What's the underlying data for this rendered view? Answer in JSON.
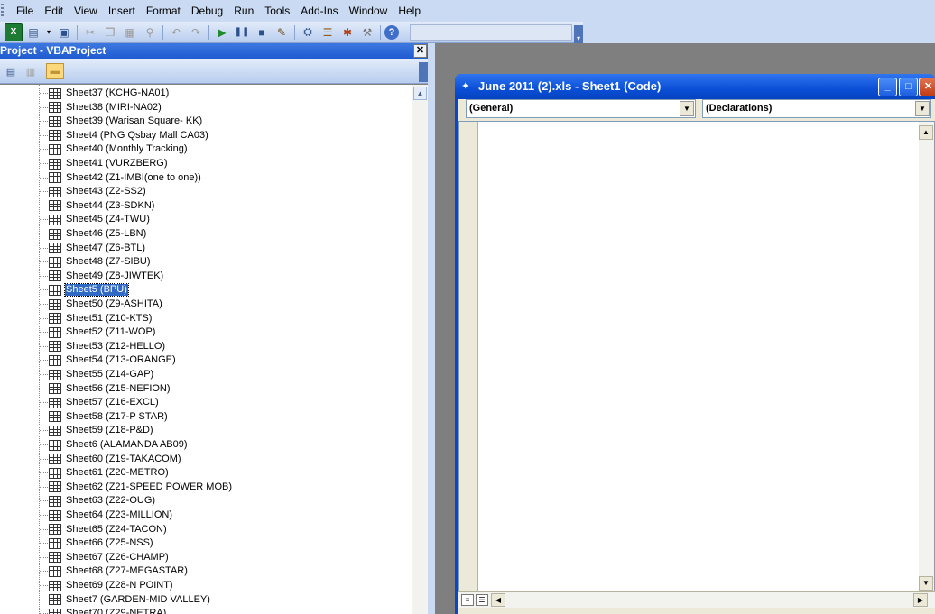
{
  "menu": {
    "items": [
      "File",
      "Edit",
      "View",
      "Insert",
      "Format",
      "Debug",
      "Run",
      "Tools",
      "Add-Ins",
      "Window",
      "Help"
    ]
  },
  "toolbar": {
    "icons": [
      "excel-icon",
      "insert-module-icon",
      "dropdown-icon",
      "save-icon",
      "cut-icon",
      "copy-icon",
      "paste-icon",
      "find-icon",
      "undo-icon",
      "redo-icon",
      "run-icon",
      "break-icon",
      "reset-icon",
      "design-mode-icon",
      "project-explorer-icon",
      "properties-icon",
      "object-browser-icon",
      "toolbox-icon",
      "help-icon"
    ]
  },
  "project": {
    "title": "Project - VBAProject",
    "close": "✕",
    "items": [
      "Sheet37 (KCHG-NA01)",
      "Sheet38 (MIRI-NA02)",
      "Sheet39 (Warisan Square- KK)",
      "Sheet4 (PNG Qsbay Mall CA03)",
      "Sheet40 (Monthly Tracking)",
      "Sheet41 (VURZBERG)",
      "Sheet42 (Z1-IMBI(one to one))",
      "Sheet43 (Z2-SS2)",
      "Sheet44 (Z3-SDKN)",
      "Sheet45 (Z4-TWU)",
      "Sheet46 (Z5-LBN)",
      "Sheet47 (Z6-BTL)",
      "Sheet48 (Z7-SIBU)",
      "Sheet49 (Z8-JIWTEK)",
      "Sheet5 (BPU)",
      "Sheet50 (Z9-ASHITA)",
      "Sheet51 (Z10-KTS)",
      "Sheet52 (Z11-WOP)",
      "Sheet53 (Z12-HELLO)",
      "Sheet54 (Z13-ORANGE)",
      "Sheet55 (Z14-GAP)",
      "Sheet56 (Z15-NEFION)",
      "Sheet57 (Z16-EXCL)",
      "Sheet58 (Z17-P STAR)",
      "Sheet59 (Z18-P&D)",
      "Sheet6 (ALAMANDA AB09)",
      "Sheet60 (Z19-TAKACOM)",
      "Sheet61 (Z20-METRO)",
      "Sheet62 (Z21-SPEED POWER MOB)",
      "Sheet63 (Z22-OUG)",
      "Sheet64 (Z23-MILLION)",
      "Sheet65 (Z24-TACON)",
      "Sheet66 (Z25-NSS)",
      "Sheet67 (Z26-CHAMP)",
      "Sheet68 (Z27-MEGASTAR)",
      "Sheet69 (Z28-N POINT)",
      "Sheet7 (GARDEN-MID VALLEY)",
      "Sheet70 (Z29-NETRA)"
    ],
    "selected_index": 14
  },
  "code_window": {
    "title": "June 2011 (2).xls - Sheet1 (Code)",
    "object_combo": "(General)",
    "procedure_combo": "(Declarations)"
  },
  "colors": {
    "selection": "#316ac5",
    "titlebar": "#0a4fd6",
    "menubar": "#c9daf2"
  }
}
